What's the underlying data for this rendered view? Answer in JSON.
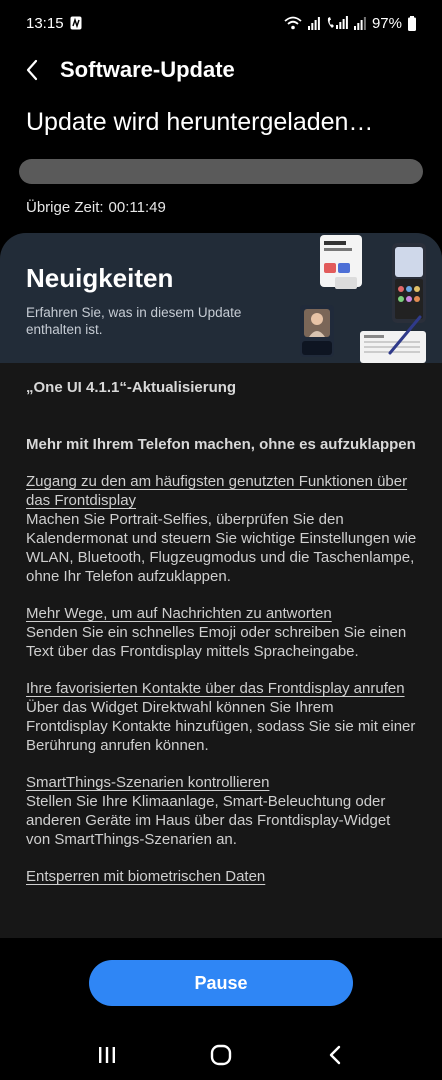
{
  "status_bar": {
    "time": "13:15",
    "battery": "97%",
    "icons": [
      "nfc-icon",
      "wifi-icon",
      "signal-icon",
      "volte-signal-icon",
      "signal-icon",
      "battery-icon"
    ]
  },
  "header": {
    "title": "Software-Update",
    "back_icon": "back-arrow-icon"
  },
  "download": {
    "title": "Update wird heruntergeladen…",
    "progress": 0.0,
    "remaining_label": "Übrige Zeit:",
    "remaining_value": "00:11:49"
  },
  "card": {
    "banner": {
      "title": "Neuigkeiten",
      "subtitle": "Erfahren Sie, was in diesem Update enthalten ist."
    },
    "version": "„One UI 4.1.1“-Aktualisierung",
    "headline": "Mehr mit Ihrem Telefon machen, ohne es aufzuklappen",
    "sections": [
      {
        "title": "Zugang zu den am häufigsten genutzten Funktionen über das Frontdisplay",
        "body": "Machen Sie Portrait-Selfies, überprüfen Sie den Kalendermonat und steuern Sie wichtige Einstellungen wie WLAN, Bluetooth, Flugzeugmodus und die Taschenlampe, ohne Ihr Telefon aufzuklappen."
      },
      {
        "title": "Mehr Wege, um auf Nachrichten zu antworten",
        "body": "Senden Sie ein schnelles Emoji oder schreiben Sie einen Text über das Frontdisplay mittels Spracheingabe."
      },
      {
        "title": "Ihre favorisierten Kontakte über das Frontdisplay anrufen",
        "body": "Über das Widget Direktwahl können Sie Ihrem Frontdisplay Kontakte hinzufügen, sodass Sie sie mit einer Berührung anrufen können."
      },
      {
        "title": "SmartThings-Szenarien kontrollieren",
        "body": "Stellen Sie Ihre Klimaanlage, Smart-Beleuchtung oder anderen Geräte im Haus über das Frontdisplay-Widget von SmartThings-Szenarien an."
      },
      {
        "title": "Entsperren mit biometrischen Daten",
        "body": ""
      }
    ]
  },
  "pause_button": {
    "label": "Pause"
  },
  "nav_bar": {
    "recents_icon": "recents-icon",
    "home_icon": "home-icon",
    "back_icon": "back-icon"
  },
  "colors": {
    "background": "#000000",
    "card": "#171717",
    "banner": "#222c38",
    "accent": "#2f86f5",
    "progress_track": "#5a5a5a"
  }
}
